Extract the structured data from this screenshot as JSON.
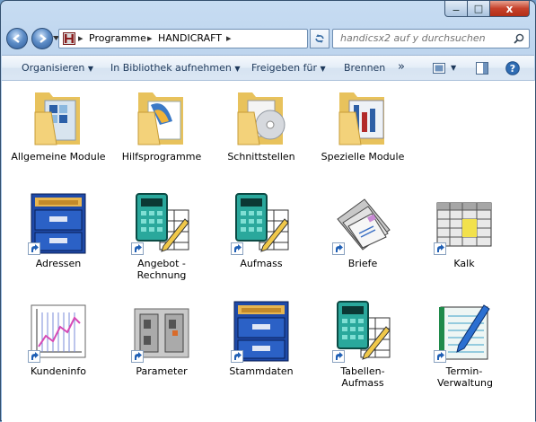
{
  "window": {
    "close_symbol": "x",
    "min_symbol": "−",
    "max_symbol": "□"
  },
  "address": {
    "crumbs": [
      "Programme",
      "HANDICRAFT"
    ],
    "separator": "▸",
    "search_placeholder": "handicsx2 auf y durchsuchen"
  },
  "toolbar": {
    "organize": "Organisieren",
    "library": "In Bibliothek aufnehmen",
    "share": "Freigeben für",
    "burn": "Brennen",
    "more": "»"
  },
  "items": [
    {
      "label": "Allgemeine Module",
      "icon": "folder-icon"
    },
    {
      "label": "Hilfsprogramme",
      "icon": "folder-icon"
    },
    {
      "label": "Schnittstellen",
      "icon": "folder-icon"
    },
    {
      "label": "Spezielle Module",
      "icon": "folder-icon"
    },
    {
      "label": "Adressen",
      "icon": "file-cabinet-icon"
    },
    {
      "label": "Angebot - Rechnung",
      "icon": "calculator-icon"
    },
    {
      "label": "Aufmass",
      "icon": "calculator-icon"
    },
    {
      "label": "Briefe",
      "icon": "letters-icon"
    },
    {
      "label": "Kalk",
      "icon": "spreadsheet-icon"
    },
    {
      "label": "Kundeninfo",
      "icon": "chart-icon"
    },
    {
      "label": "Parameter",
      "icon": "switches-icon"
    },
    {
      "label": "Stammdaten",
      "icon": "file-cabinet-icon"
    },
    {
      "label": "Tabellen-Aufmass",
      "icon": "calculator-icon"
    },
    {
      "label": "Termin-Verwaltung",
      "icon": "notebook-icon"
    }
  ],
  "colors": {
    "toolbar_text": "#1e395b",
    "close_red": "#c6412b",
    "folder": "#f3d27a"
  }
}
